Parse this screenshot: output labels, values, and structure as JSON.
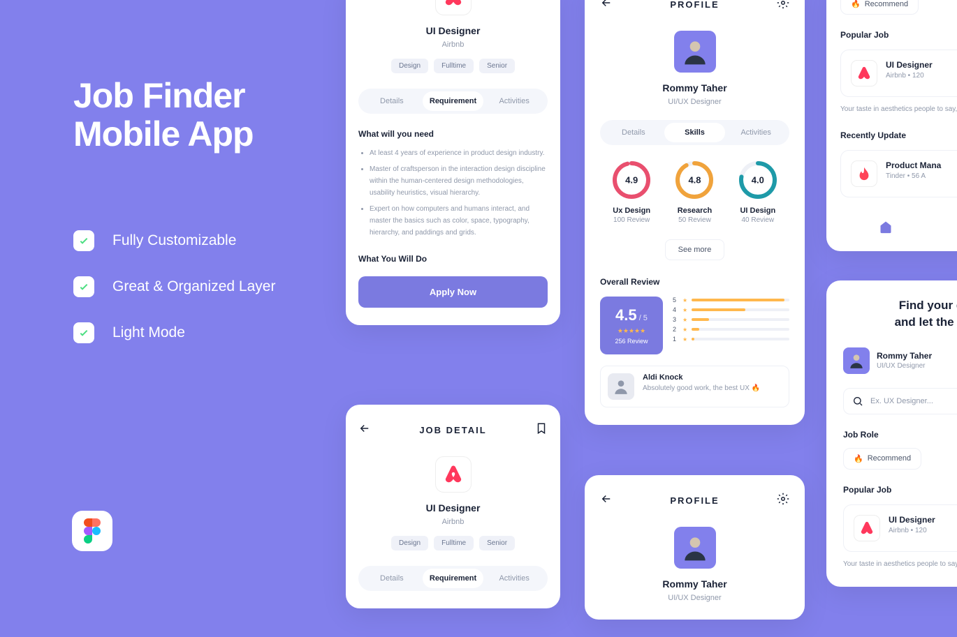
{
  "hero": {
    "title_l1": "Job Finder",
    "title_l2": "Mobile App"
  },
  "features": [
    "Fully Customizable",
    "Great & Organized Layer",
    "Light Mode"
  ],
  "jobDetail": {
    "headerTitle": "JOB DETAIL",
    "title": "UI Designer",
    "company": "Airbnb",
    "tags": [
      "Design",
      "Fulltime",
      "Senior"
    ],
    "tabs": [
      "Details",
      "Requirement",
      "Activities"
    ],
    "needH": "What will you need",
    "needs": [
      "At least 4 years of experience in product design industry.",
      "Master of craftsperson in the interaction design discipline within the human-centered design methodologies, usability heuristics, visual hierarchy.",
      "Expert on how computers and humans interact, and master the basics such as color, space, typography, hierarchy, and paddings and grids."
    ],
    "doH": "What You Will Do",
    "applyLabel": "Apply Now"
  },
  "profile": {
    "headerTitle": "PROFILE",
    "name": "Rommy Taher",
    "role": "UI/UX Designer",
    "tabs": [
      "Details",
      "Skills",
      "Activities"
    ],
    "skills": [
      {
        "score": "4.9",
        "name": "Ux Design",
        "rev": "100 Review",
        "color": "#E94F6E",
        "pct": 96
      },
      {
        "score": "4.8",
        "name": "Research",
        "rev": "50 Review",
        "color": "#F0A33C",
        "pct": 92
      },
      {
        "score": "4.0",
        "name": "UI Design",
        "rev": "40 Review",
        "color": "#1E9AA8",
        "pct": 78
      }
    ],
    "seeMore": "See more",
    "overallH": "Overall Review",
    "score": "4.5",
    "scoreOf": " / 5",
    "reviewCount": "256 Review",
    "bars": [
      {
        "n": "5",
        "w": 95
      },
      {
        "n": "4",
        "w": 55
      },
      {
        "n": "3",
        "w": 18
      },
      {
        "n": "2",
        "w": 8
      },
      {
        "n": "1",
        "w": 3
      }
    ],
    "reviewer": {
      "name": "Aldi Knock",
      "text": "Absolutely good work, the best UX 🔥"
    }
  },
  "home": {
    "recommend": "Recommend",
    "popularH": "Popular Job",
    "pop": {
      "title": "UI Designer",
      "meta": "Airbnb  •  120",
      "desc": "Your taste in aesthetics people to say, \"what a s"
    },
    "recentH": "Recently Update",
    "rec": {
      "title": "Product Mana",
      "meta": "Tinder  •  56 A"
    }
  },
  "find": {
    "title_l1": "Find your d",
    "title_l2": "and let the jo",
    "user": {
      "name": "Rommy Taher",
      "role": "UI/UX Designer"
    },
    "searchPh": "Ex. UX Designer...",
    "roleH": "Job Role",
    "recommend": "Recommend",
    "popularH": "Popular Job",
    "pop": {
      "title": "UI Designer",
      "meta": "Airbnb  •  120",
      "desc": "Your taste in aesthetics people to say, \"what a s"
    }
  }
}
